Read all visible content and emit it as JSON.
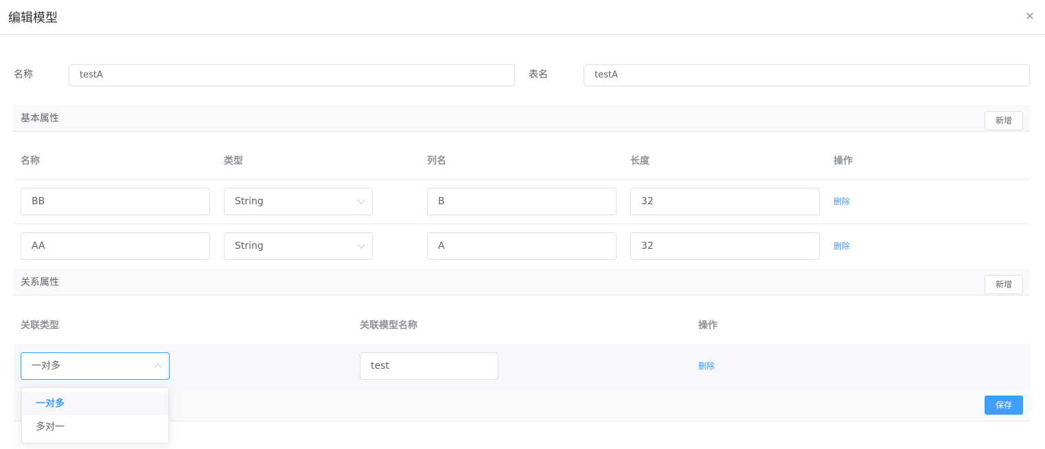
{
  "dialog": {
    "title": "编辑模型",
    "close_glyph": "✕"
  },
  "form": {
    "name_label": "名称",
    "name_value": "testA",
    "table_label": "表名",
    "table_value": "testA"
  },
  "basic": {
    "title": "基本属性",
    "add_label": "新增",
    "headers": [
      "名称",
      "类型",
      "列名",
      "长度",
      "操作"
    ],
    "rows": [
      {
        "name": "BB",
        "type": "String",
        "column": "B",
        "length": "32",
        "action": "删除"
      },
      {
        "name": "AA",
        "type": "String",
        "column": "A",
        "length": "32",
        "action": "删除"
      }
    ]
  },
  "relation": {
    "title": "关系属性",
    "add_label": "新增",
    "headers": [
      "关联类型",
      "关联模型名称",
      "操作"
    ],
    "rows": [
      {
        "type": "一对多",
        "model": "test",
        "action": "删除"
      }
    ],
    "dropdown_options": [
      "一对多",
      "多对一"
    ],
    "dropdown_selected": "一对多"
  },
  "footer": {
    "save_label": "保存"
  },
  "colors": {
    "primary": "#409eff",
    "border": "#dcdfe6",
    "text": "#606266",
    "header_text": "#909399"
  },
  "icons": {
    "close": "close-icon",
    "select_arrow": "chevron-down-icon"
  }
}
